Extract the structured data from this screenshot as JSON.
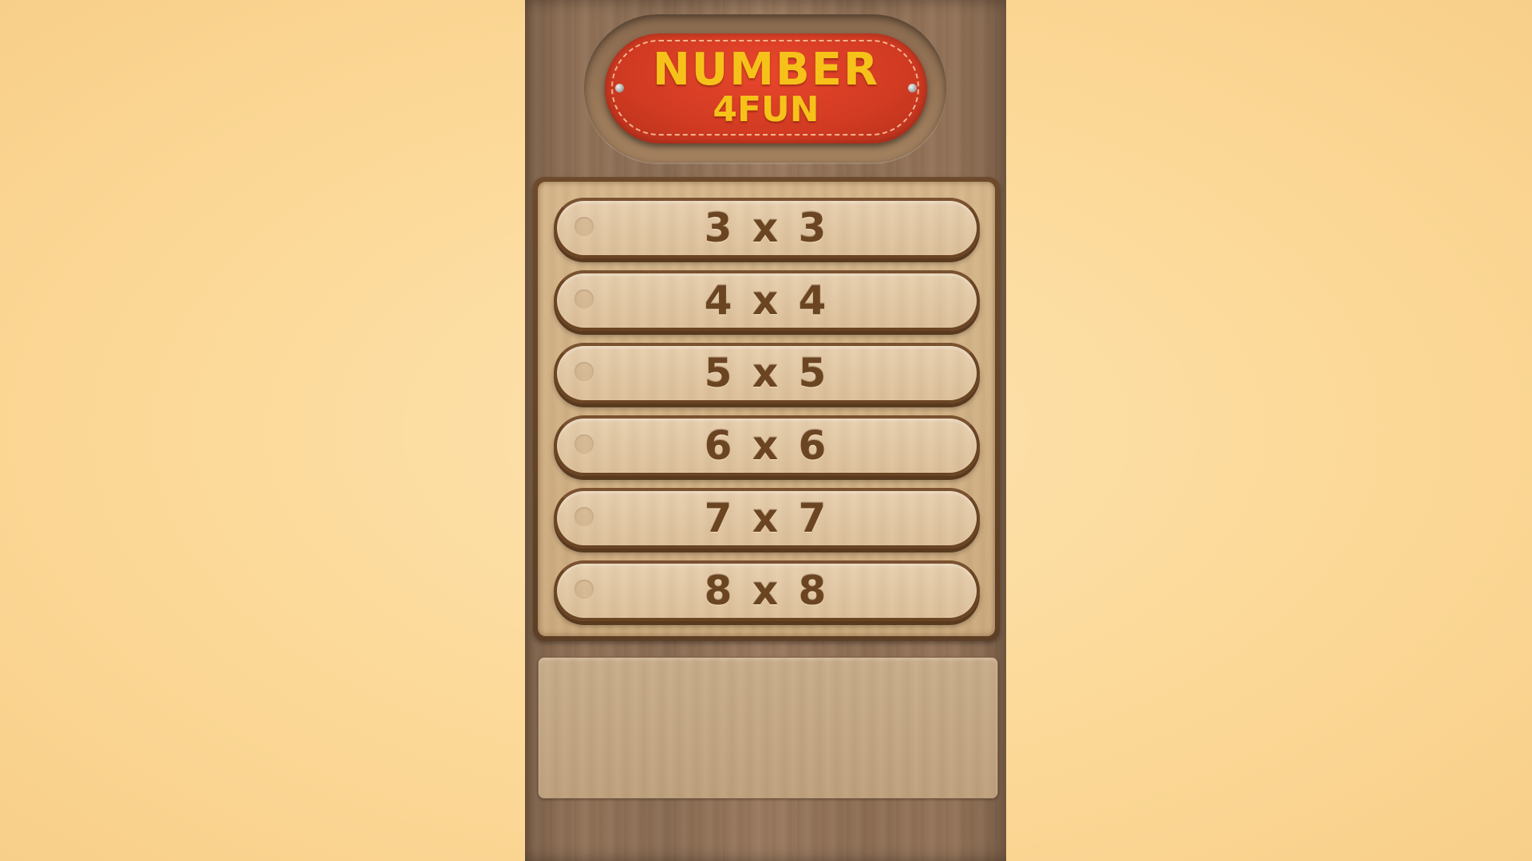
{
  "logo": {
    "title": "NUMBER",
    "subtitle": "4FUN"
  },
  "menu": {
    "modes": [
      {
        "label": "3 x 3"
      },
      {
        "label": "4 x 4"
      },
      {
        "label": "5 x 5"
      },
      {
        "label": "6 x 6"
      },
      {
        "label": "7 x 7"
      },
      {
        "label": "8 x 8"
      }
    ]
  },
  "colors": {
    "background": "#fcd998",
    "wood": "#8d6e54",
    "badge": "#d13b22",
    "logo_text": "#f6c21a",
    "button_text": "#6b4522"
  }
}
